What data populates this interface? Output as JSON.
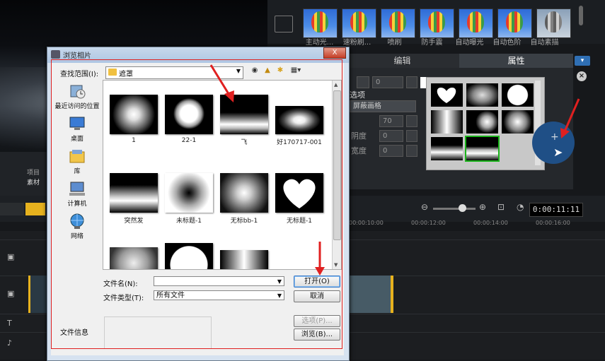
{
  "app": {
    "panel_labels": [
      "项目",
      "素材"
    ],
    "filter_thumbs": [
      "主动光...",
      "速粉刷...",
      "喷刷",
      "防手震",
      "自动曝光",
      "自动色阶",
      "自动素描"
    ],
    "tabs": [
      {
        "label": "编辑"
      },
      {
        "label": "属性"
      }
    ],
    "properties": {
      "value1": "0",
      "section_label": "选项",
      "mask_mode": "屏蔽画格",
      "value2": "70",
      "label_a": "阴度",
      "value3": "0",
      "label_b": "宽度",
      "value4": "0"
    },
    "timecode": "0:00:11:11",
    "ruler": [
      "00:00:10:00",
      "00:00:12:00",
      "00:00:14:00",
      "00:00:16:00"
    ]
  },
  "dialog": {
    "title": "浏览相片",
    "close_label": "X",
    "lookin_label": "查找范围(I):",
    "lookin_value": "遮罩",
    "places": [
      {
        "label": "最近访问的位置",
        "icon": "recent-places-icon"
      },
      {
        "label": "桌面",
        "icon": "desktop-icon"
      },
      {
        "label": "库",
        "icon": "libraries-icon"
      },
      {
        "label": "计算机",
        "icon": "computer-icon"
      },
      {
        "label": "网络",
        "icon": "network-icon"
      }
    ],
    "files": [
      {
        "name": "1",
        "kind": "radial-soft"
      },
      {
        "name": "22-1",
        "kind": "radial-hard"
      },
      {
        "name": "飞",
        "kind": "horizon"
      },
      {
        "name": "好170717-001",
        "kind": "radial-wide"
      },
      {
        "name": "突然发",
        "kind": "cloud-horizon"
      },
      {
        "name": "未标题-1",
        "kind": "radial-inverse"
      },
      {
        "name": "无标bb-1",
        "kind": "radial-gray"
      },
      {
        "name": "无标题-1",
        "kind": "heart"
      },
      {
        "name": "",
        "kind": "cloud"
      },
      {
        "name": "",
        "kind": "circle-white"
      },
      {
        "name": "",
        "kind": "gradient-v"
      }
    ],
    "filename_label": "文件名(N):",
    "filename_value": "",
    "filetype_label": "文件类型(T):",
    "filetype_value": "所有文件",
    "open_label": "打开(O)",
    "cancel_label": "取消",
    "fileinfo_label": "文件信息",
    "options_label": "选项(P)...",
    "browse_label": "浏览(B)..."
  }
}
